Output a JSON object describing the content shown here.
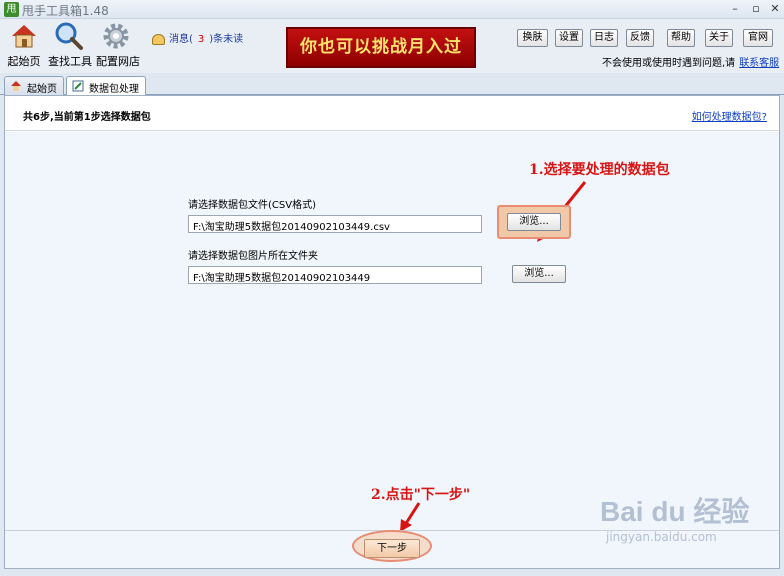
{
  "window": {
    "icon_text": "甩",
    "title": "甩手工具箱",
    "version": "1.48"
  },
  "toolbar": {
    "home": "起始页",
    "find_tools": "查找工具",
    "config_shop": "配置网店"
  },
  "message": {
    "prefix": "消息(",
    "count": "3",
    "suffix": ")条未读"
  },
  "promo": "你也可以挑战月入过万!",
  "top_buttons": [
    "换肤",
    "设置",
    "日志",
    "反馈",
    "帮助",
    "关于",
    "官网"
  ],
  "help_line": {
    "text": "不会使用或使用时遇到问题,请",
    "link": "联系客服"
  },
  "tabs": [
    {
      "label": "起始页",
      "active": false
    },
    {
      "label": "数据包处理",
      "active": true
    }
  ],
  "step": {
    "text": "共6步,当前第1步选择数据包",
    "help_link": "如何处理数据包?"
  },
  "form": {
    "csv_label": "请选择数据包文件(CSV格式)",
    "csv_value": "F:\\淘宝助理5数据包20140902103449.csv",
    "folder_label": "请选择数据包图片所在文件夹",
    "folder_value": "F:\\淘宝助理5数据包20140902103449",
    "browse_label": "浏览..."
  },
  "annotations": {
    "step1": "1.选择要处理的数据包",
    "step2": "2.点击\"下一步\""
  },
  "next_button": "下一步",
  "watermark": {
    "logo": "Bai du 经验",
    "url": "jingyan.baidu.com"
  },
  "colors": {
    "annotation": "#d81515",
    "highlight": "#e88c74",
    "link": "#1040c0"
  }
}
